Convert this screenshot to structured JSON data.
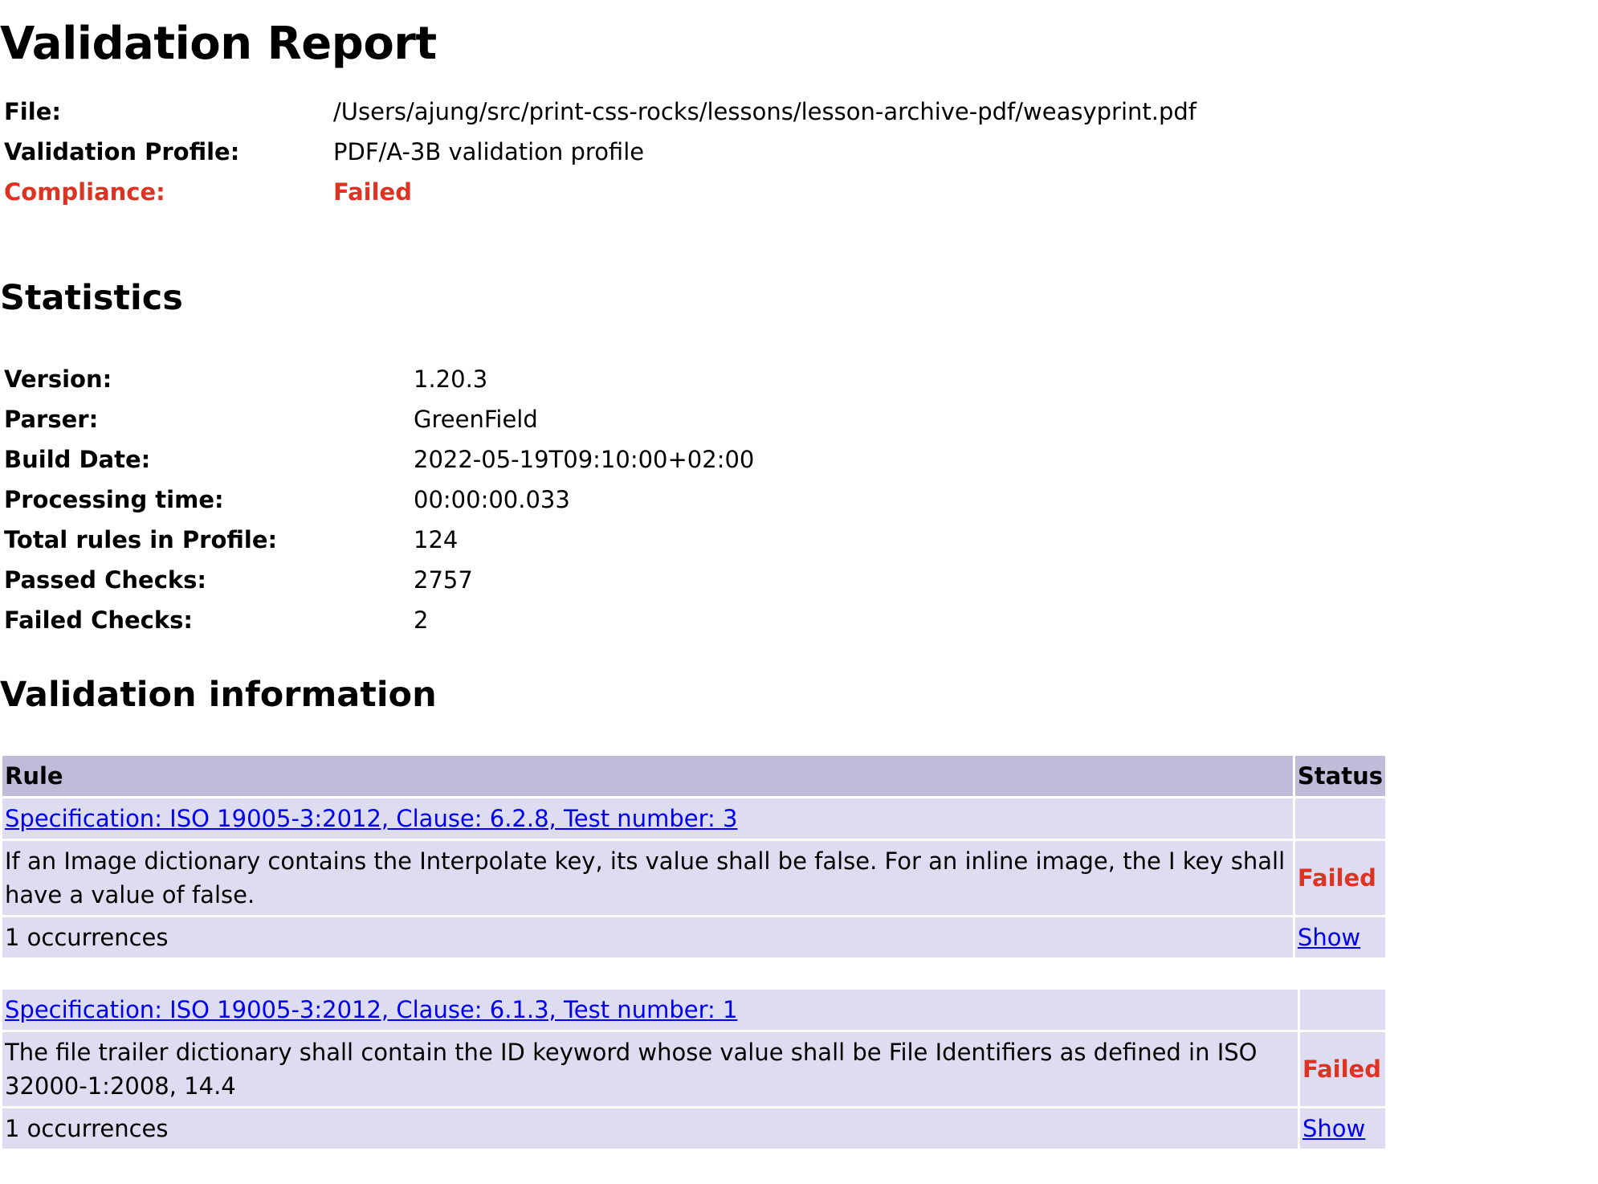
{
  "title": "Validation Report",
  "summary": {
    "file_label": "File:",
    "file_value": "/Users/ajung/src/print-css-rocks/lessons/lesson-archive-pdf/weasyprint.pdf",
    "profile_label": "Validation Profile:",
    "profile_value": "PDF/A-3B validation profile",
    "compliance_label": "Compliance:",
    "compliance_value": "Failed"
  },
  "statistics": {
    "heading": "Statistics",
    "rows": [
      {
        "label": "Version:",
        "value": "1.20.3"
      },
      {
        "label": "Parser:",
        "value": "GreenField"
      },
      {
        "label": "Build Date:",
        "value": "2022-05-19T09:10:00+02:00"
      },
      {
        "label": "Processing time:",
        "value": "00:00:00.033"
      },
      {
        "label": "Total rules in Profile:",
        "value": "124"
      },
      {
        "label": "Passed Checks:",
        "value": "2757"
      },
      {
        "label": "Failed Checks:",
        "value": "2"
      }
    ]
  },
  "validation": {
    "heading": "Validation information",
    "col_rule": "Rule",
    "col_status": "Status",
    "rules": [
      {
        "spec": "Specification: ISO 19005-3:2012, Clause: 6.2.8, Test number: 3",
        "description": "If an Image dictionary contains the Interpolate key, its value shall be false. For an inline image, the I key shall have a value of false.",
        "status": "Failed",
        "occurrences": "1 occurrences",
        "show_label": "Show"
      },
      {
        "spec": "Specification: ISO 19005-3:2012, Clause: 6.1.3, Test number: 1",
        "description": "The file trailer dictionary shall contain the ID keyword whose value shall be File Identifiers as defined in ISO 32000-1:2008, 14.4",
        "status": "Failed",
        "occurrences": "1 occurrences",
        "show_label": "Show"
      }
    ]
  },
  "colors": {
    "failed": "#dd3322",
    "header_bg": "#bebcd8",
    "row_bg": "#dddcf0",
    "link": "#0000ee"
  }
}
